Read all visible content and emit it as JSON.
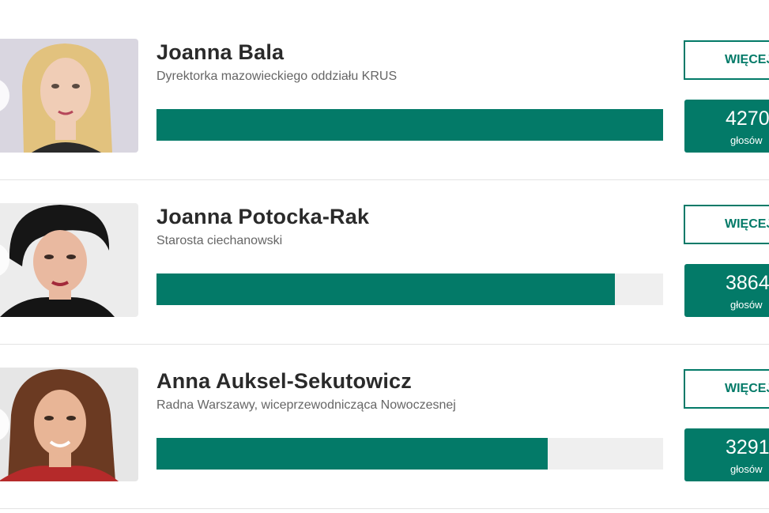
{
  "candidates": [
    {
      "name": "Joanna Bala",
      "role": "Dyrektorka mazowieckiego oddziału KRUS",
      "more_label": "WIĘCEJ",
      "votes": "4270",
      "votes_label": "głosów",
      "share": 1.0,
      "photo": {
        "bg": "#d9d6e0",
        "hair": "#e2c27e",
        "skin": "#f0cdb6",
        "clothes": "#2a2a2a"
      }
    },
    {
      "name": "Joanna Potocka-Rak",
      "role": "Starosta ciechanowski",
      "more_label": "WIĘCEJ",
      "votes": "3864",
      "votes_label": "głosów",
      "share": 0.905,
      "photo": {
        "bg": "#ececec",
        "hair": "#161616",
        "skin": "#e9b9a0",
        "clothes": "#151515"
      }
    },
    {
      "name": "Anna Auksel-Sekutowicz",
      "role": "Radna Warszawy, wiceprzewodnicząca Nowoczesnej",
      "more_label": "WIĘCEJ",
      "votes": "3291",
      "votes_label": "głosów",
      "share": 0.772,
      "photo": {
        "bg": "#e6e6e6",
        "hair": "#6b3a22",
        "skin": "#e8b596",
        "clothes": "#b52a2a"
      }
    }
  ],
  "accent_color": "#037a68"
}
